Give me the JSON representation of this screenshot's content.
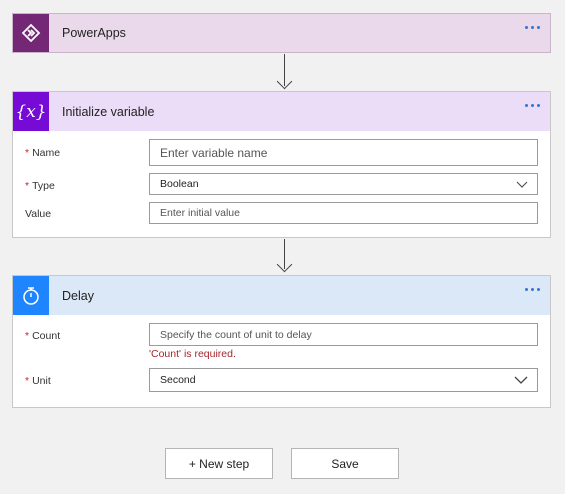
{
  "powerapps": {
    "title": "PowerApps",
    "icon": "powerapps-icon",
    "color": "#742774"
  },
  "init_variable": {
    "title": "Initialize variable",
    "icon": "variable-braces-icon",
    "icon_text": "{x}",
    "color": "#770bd6",
    "name_label": "Name",
    "name_placeholder": "Enter variable name",
    "type_label": "Type",
    "type_value": "Boolean",
    "value_label": "Value",
    "value_placeholder": "Enter initial value"
  },
  "delay": {
    "title": "Delay",
    "icon": "stopwatch-icon",
    "color": "#1f85ff",
    "count_label": "Count",
    "count_placeholder": "Specify the count of unit to delay",
    "count_error": "'Count' is required.",
    "unit_label": "Unit",
    "unit_value": "Second"
  },
  "required_marker": "*",
  "buttons": {
    "new_step": "+ New step",
    "save": "Save"
  }
}
